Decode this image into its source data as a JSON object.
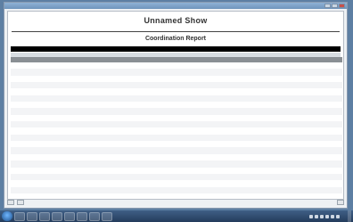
{
  "window": {
    "title": ""
  },
  "report": {
    "show_title": "Unnamed Show",
    "report_title": "Coordination Report"
  },
  "table": {
    "rows": [
      {
        "c1": "",
        "c2": "",
        "c3": "",
        "c4": "",
        "c5": "",
        "c6": "",
        "c7": ""
      },
      {
        "c1": "",
        "c2": "",
        "c3": "",
        "c4": "",
        "c5": "",
        "c6": "",
        "c7": ""
      },
      {
        "c1": "",
        "c2": "",
        "c3": "",
        "c4": "",
        "c5": "",
        "c6": "",
        "c7": ""
      },
      {
        "c1": "",
        "c2": "",
        "c3": "",
        "c4": "",
        "c5": "",
        "c6": "",
        "c7": ""
      },
      {
        "c1": "",
        "c2": "",
        "c3": "",
        "c4": "",
        "c5": "",
        "c6": "",
        "c7": ""
      },
      {
        "c1": "",
        "c2": "",
        "c3": "",
        "c4": "",
        "c5": "",
        "c6": "",
        "c7": ""
      },
      {
        "c1": "",
        "c2": "",
        "c3": "",
        "c4": "",
        "c5": "",
        "c6": "",
        "c7": ""
      },
      {
        "c1": "",
        "c2": "",
        "c3": "",
        "c4": "",
        "c5": "",
        "c6": "",
        "c7": ""
      },
      {
        "c1": "",
        "c2": "",
        "c3": "",
        "c4": "",
        "c5": "",
        "c6": "",
        "c7": ""
      },
      {
        "c1": "",
        "c2": "",
        "c3": "",
        "c4": "",
        "c5": "",
        "c6": "",
        "c7": ""
      },
      {
        "c1": "",
        "c2": "",
        "c3": "",
        "c4": "",
        "c5": "",
        "c6": "",
        "c7": ""
      },
      {
        "c1": "",
        "c2": "",
        "c3": "",
        "c4": "",
        "c5": "",
        "c6": "",
        "c7": ""
      },
      {
        "c1": "",
        "c2": "",
        "c3": "",
        "c4": "",
        "c5": "",
        "c6": "",
        "c7": ""
      },
      {
        "c1": "",
        "c2": "",
        "c3": "",
        "c4": "",
        "c5": "",
        "c6": "",
        "c7": ""
      },
      {
        "c1": "",
        "c2": "",
        "c3": "",
        "c4": "",
        "c5": "",
        "c6": "",
        "c7": ""
      },
      {
        "c1": "",
        "c2": "",
        "c3": "",
        "c4": "",
        "c5": "",
        "c6": "",
        "c7": ""
      },
      {
        "c1": "",
        "c2": "",
        "c3": "",
        "c4": "",
        "c5": "",
        "c6": "",
        "c7": ""
      },
      {
        "c1": "",
        "c2": "",
        "c3": "",
        "c4": "",
        "c5": "",
        "c6": "",
        "c7": ""
      },
      {
        "c1": "",
        "c2": "",
        "c3": "",
        "c4": "",
        "c5": "",
        "c6": "",
        "c7": ""
      },
      {
        "c1": "",
        "c2": "",
        "c3": "",
        "c4": "",
        "c5": "",
        "c6": "",
        "c7": ""
      }
    ]
  },
  "colors": {
    "desktop": "#5d7fa3",
    "header_row": "#8a8f94",
    "band": "#000000",
    "taskbar": "#2f4a6e"
  },
  "taskbar": {
    "icons": [
      "start-orb-icon",
      "explorer-icon",
      "browser-icon",
      "media-icon",
      "app-icon",
      "app-icon",
      "app-icon",
      "app-icon",
      "app-icon"
    ]
  }
}
